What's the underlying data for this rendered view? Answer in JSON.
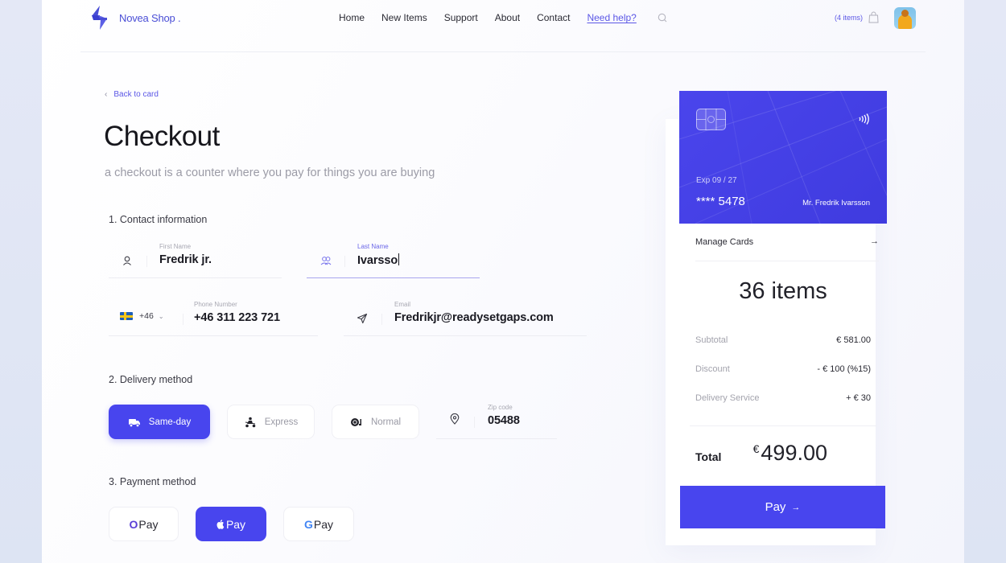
{
  "header": {
    "brand": "Novea Shop .",
    "nav": [
      "Home",
      "New Items",
      "Support",
      "About",
      "Contact"
    ],
    "help_link": "Need help?",
    "cart_count": "(4 items)",
    "icons": {
      "logo": "lightning-bolt-icon",
      "search": "search-icon",
      "cart": "shopping-bag-icon",
      "avatar": "user-avatar"
    }
  },
  "checkout": {
    "back_link": "Back to card",
    "title": "Checkout",
    "subtitle": "a checkout is a counter where you pay for things you are buying",
    "contact": {
      "section_label": "1. Contact information",
      "first_name": {
        "label": "First Name",
        "value": "Fredrik jr.",
        "icon": "user-icon"
      },
      "last_name": {
        "label": "Last Name",
        "value": "Ivarsso",
        "icon": "users-icon",
        "focused": true
      },
      "phone": {
        "label": "Phone Number",
        "value": "+46 311 223 721",
        "country_code": "+46",
        "country_flag": "sweden-flag-icon"
      },
      "email": {
        "label": "Email",
        "value": "Fredrikjr@readysetgaps.com",
        "icon": "send-icon"
      }
    },
    "delivery": {
      "section_label": "2. Delivery method",
      "options": [
        {
          "label": "Same-day",
          "icon": "truck-icon",
          "selected": true
        },
        {
          "label": "Express",
          "icon": "scooter-icon",
          "selected": false
        },
        {
          "label": "Normal",
          "icon": "snail-icon",
          "selected": false
        }
      ],
      "zip": {
        "label": "Zip code",
        "value": "05488",
        "icon": "location-pin-icon"
      }
    },
    "payment": {
      "section_label": "3. Payment method",
      "options": [
        {
          "mark": "O",
          "label": "Pay",
          "name": "opay",
          "selected": false
        },
        {
          "mark": "",
          "label": "Pay",
          "name": "apple-pay",
          "selected": true
        },
        {
          "mark": "G",
          "label": "Pay",
          "name": "google-pay",
          "selected": false
        }
      ]
    }
  },
  "summary": {
    "card": {
      "expiry": "Exp  09 / 27",
      "number": "**** 5478",
      "holder": "Mr. Fredrik Ivarsson"
    },
    "manage_cards": "Manage Cards",
    "manage_arrow": "→",
    "items": "36 items",
    "rows": [
      {
        "label": "Subtotal",
        "value": "€ 581.00"
      },
      {
        "label": "Discount",
        "value": "- € 100 (%15)"
      },
      {
        "label": "Delivery Service",
        "value": "+ € 30"
      }
    ],
    "total_label": "Total",
    "total_currency": "€",
    "total_value": "499.00",
    "pay_label": "Pay",
    "pay_arrow": "→"
  },
  "colors": {
    "accent": "#4845ee",
    "brand": "#4a4ed6",
    "link": "#5b57e6"
  }
}
